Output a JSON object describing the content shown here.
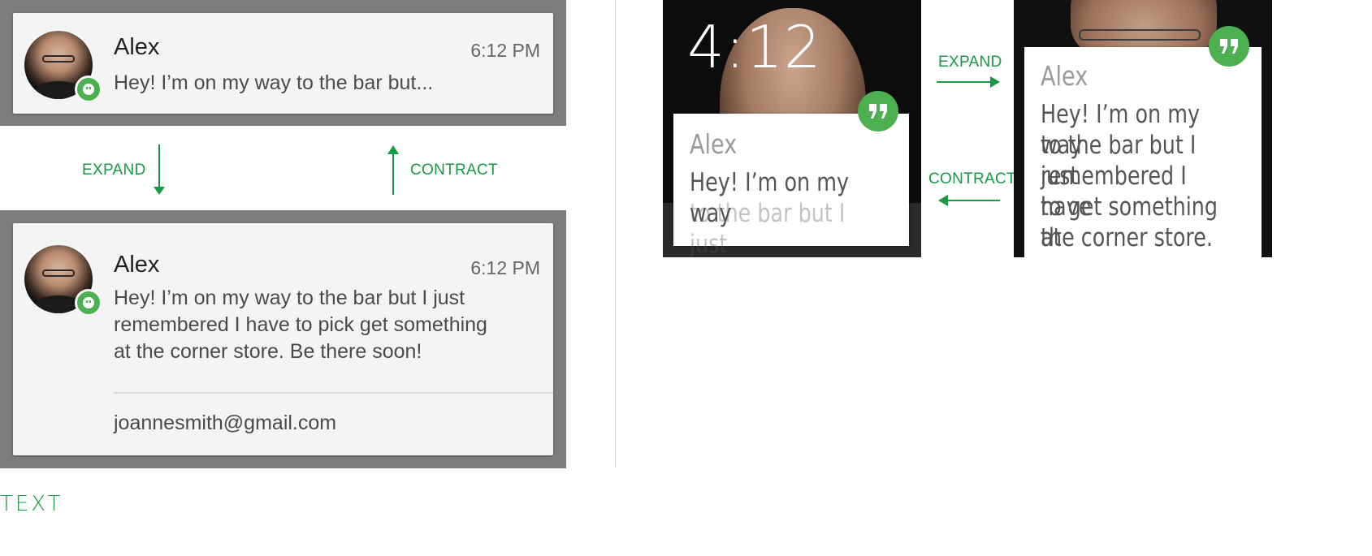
{
  "phone": {
    "collapsed": {
      "name": "Alex",
      "time": "6:12 PM",
      "message": "Hey! I’m on my way to the bar but..."
    },
    "expand_label": "EXPAND",
    "contract_label": "CONTRACT",
    "expanded": {
      "name": "Alex",
      "time": "6:12 PM",
      "message_lines": [
        "Hey! I’m on my way to the bar but I just",
        "remembered I have to pick get something",
        "at the corner store. Be there soon!"
      ],
      "account": "joannesmith@gmail.com"
    }
  },
  "watch": {
    "clock": "4:12",
    "peek": {
      "name": "Alex",
      "lines": [
        "Hey! I’m on my way",
        "to the bar but I just"
      ]
    },
    "expand_label": "EXPAND",
    "contract_label": "CONTRACT",
    "full": {
      "name": "Alex",
      "lines": [
        "Hey! I’m on my way",
        "to the bar but I just",
        "remembered I have",
        "to get something at",
        "the corner store."
      ]
    }
  },
  "section_label": "TEXT",
  "colors": {
    "accent_green": "#169a44",
    "badge_green": "#4caf50",
    "panel_gray": "#7d7d7d"
  },
  "icons": [
    "hangouts-icon",
    "arrow-down-icon",
    "arrow-up-icon",
    "arrow-right-icon",
    "arrow-left-icon",
    "quote-bubble-icon"
  ]
}
